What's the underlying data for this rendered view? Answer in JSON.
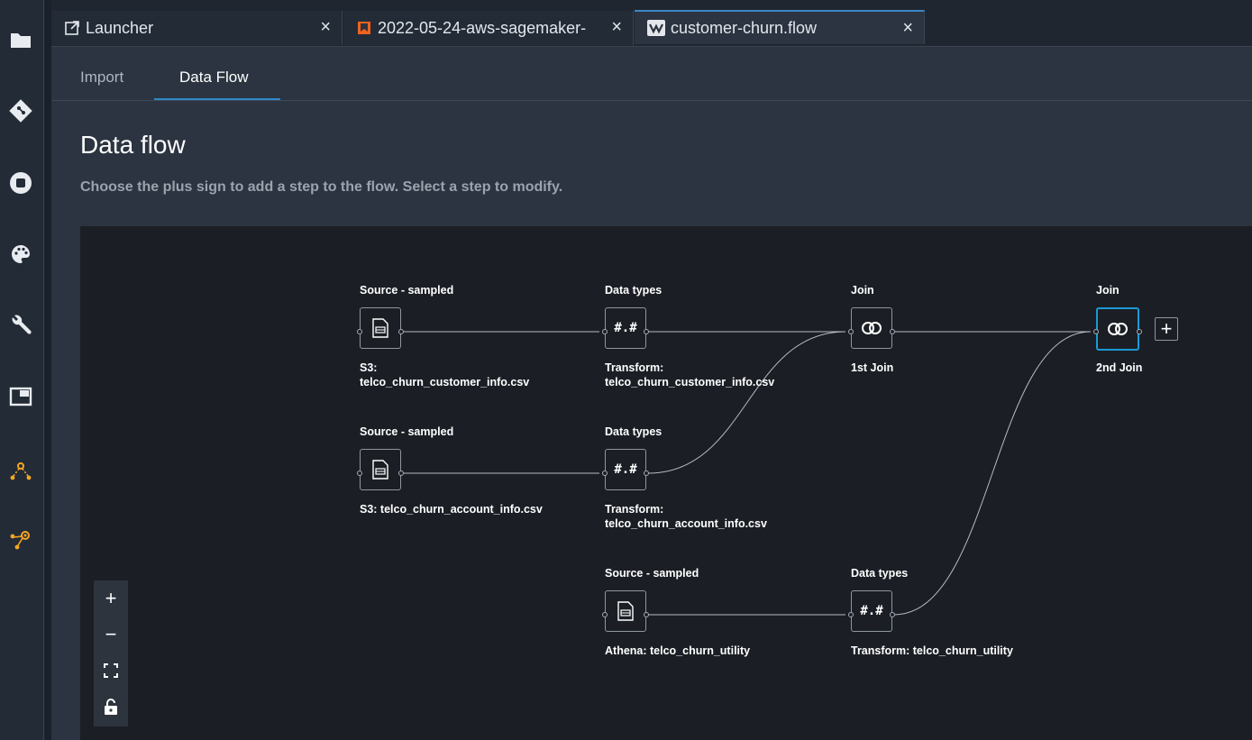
{
  "tabs": [
    {
      "label": "Launcher",
      "icon": "external-launch-icon"
    },
    {
      "label": "2022-05-24-aws-sagemaker-",
      "icon": "notebook-bookmark-icon"
    },
    {
      "label": "customer-churn.flow",
      "icon": "data-wrangler-icon"
    }
  ],
  "close_glyph": "×",
  "subtabs": {
    "import": "Import",
    "data_flow": "Data Flow"
  },
  "page": {
    "title": "Data flow",
    "subtitle": "Choose the plus sign to add a step to the flow. Select a step to modify."
  },
  "nodes": {
    "src1": {
      "header": "Source - sampled",
      "label": "S3:\ntelco_churn_customer_info.csv"
    },
    "dt1": {
      "header": "Data types",
      "label": "Transform:\ntelco_churn_customer_info.csv",
      "glyph": "#.#"
    },
    "join1": {
      "header": "Join",
      "label": "1st Join"
    },
    "join2": {
      "header": "Join",
      "label": "2nd Join"
    },
    "src2": {
      "header": "Source - sampled",
      "label": "S3: telco_churn_account_info.csv"
    },
    "dt2": {
      "header": "Data types",
      "label": "Transform:\ntelco_churn_account_info.csv",
      "glyph": "#.#"
    },
    "src3": {
      "header": "Source - sampled",
      "label": "Athena: telco_churn_utility"
    },
    "dt3": {
      "header": "Data types",
      "label": "Transform: telco_churn_utility",
      "glyph": "#.#"
    }
  },
  "add_step_glyph": "+",
  "zoom": {
    "in": "+",
    "out": "−"
  },
  "colors": {
    "accent": "#1d98d6",
    "brand_orange": "#f5a623",
    "canvas": "#1b1f25"
  }
}
